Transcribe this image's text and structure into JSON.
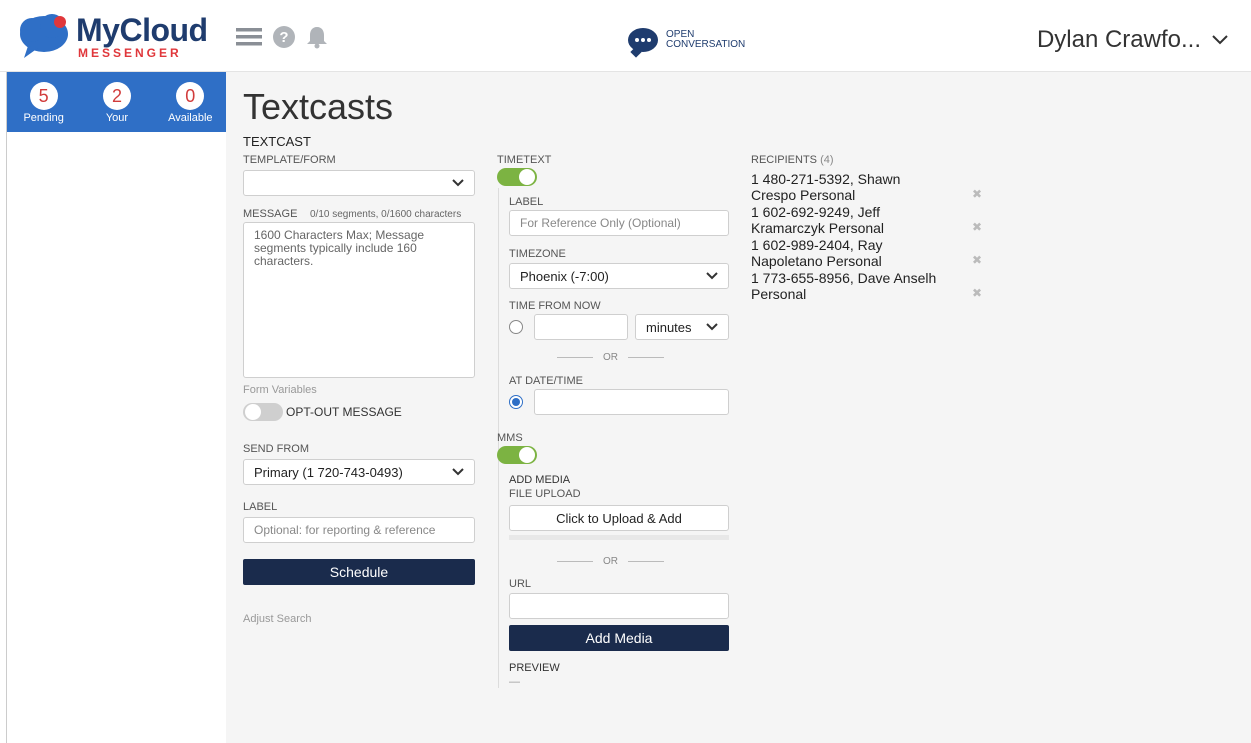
{
  "header": {
    "logo_text": "MyCloud",
    "logo_sub": "MESSENGER",
    "open_conv_line1": "OPEN",
    "open_conv_line2": "CONVERSATION",
    "user_name": "Dylan Crawfo...",
    "icons": [
      "menu-icon",
      "help-icon",
      "bell-icon"
    ]
  },
  "sidebar": {
    "counters": [
      {
        "value": "5",
        "label": "Pending"
      },
      {
        "value": "2",
        "label": "Your"
      },
      {
        "value": "0",
        "label": "Available"
      }
    ]
  },
  "main": {
    "title": "Textcasts",
    "section": "TEXTCAST",
    "template_label": "TEMPLATE/FORM",
    "message_label": "MESSAGE",
    "message_counter": "0/10 segments, 0/1600 characters",
    "message_placeholder": "1600 Characters Max; Message segments typically include 160 characters.",
    "form_variables": "Form Variables",
    "optout_label": "OPT-OUT MESSAGE",
    "send_from_label": "SEND FROM",
    "send_from_value": "Primary (1 720-743-0493)",
    "label_label": "LABEL",
    "label_placeholder": "Optional: for reporting & reference",
    "schedule_button": "Schedule",
    "adjust_search": "Adjust Search"
  },
  "timetext": {
    "title": "TIMETEXT",
    "label_label": "LABEL",
    "label_placeholder": "For Reference Only (Optional)",
    "timezone_label": "TIMEZONE",
    "timezone_value": "Phoenix (-7:00)",
    "time_from_now_label": "TIME FROM NOW",
    "unit_value": "minutes",
    "or_text": "OR",
    "at_datetime_label": "AT DATE/TIME"
  },
  "mms": {
    "title": "MMS",
    "add_media_label": "ADD MEDIA",
    "file_upload_label": "FILE UPLOAD",
    "upload_button": "Click to Upload & Add",
    "or_text": "OR",
    "url_label": "URL",
    "add_media_button": "Add Media",
    "preview_label": "PREVIEW",
    "preview_value": "—"
  },
  "recipients": {
    "label": "RECIPIENTS",
    "count": "(4)",
    "items": [
      {
        "line1": "1 480-271-5392, Shawn",
        "line2": "Crespo Personal"
      },
      {
        "line1": "1 602-692-9249, Jeff",
        "line2": "Kramarczyk Personal"
      },
      {
        "line1": "1 602-989-2404, Ray",
        "line2": "Napoletano Personal"
      },
      {
        "line1": "1 773-655-8956, Dave Anselh",
        "line2": "Personal"
      }
    ]
  },
  "colors": {
    "brand_navy": "#1f3c6e",
    "brand_red": "#e0373b",
    "sidebar_blue": "#2f6fc6",
    "toggle_green": "#7cb342",
    "button_dark": "#1a2b4c"
  }
}
